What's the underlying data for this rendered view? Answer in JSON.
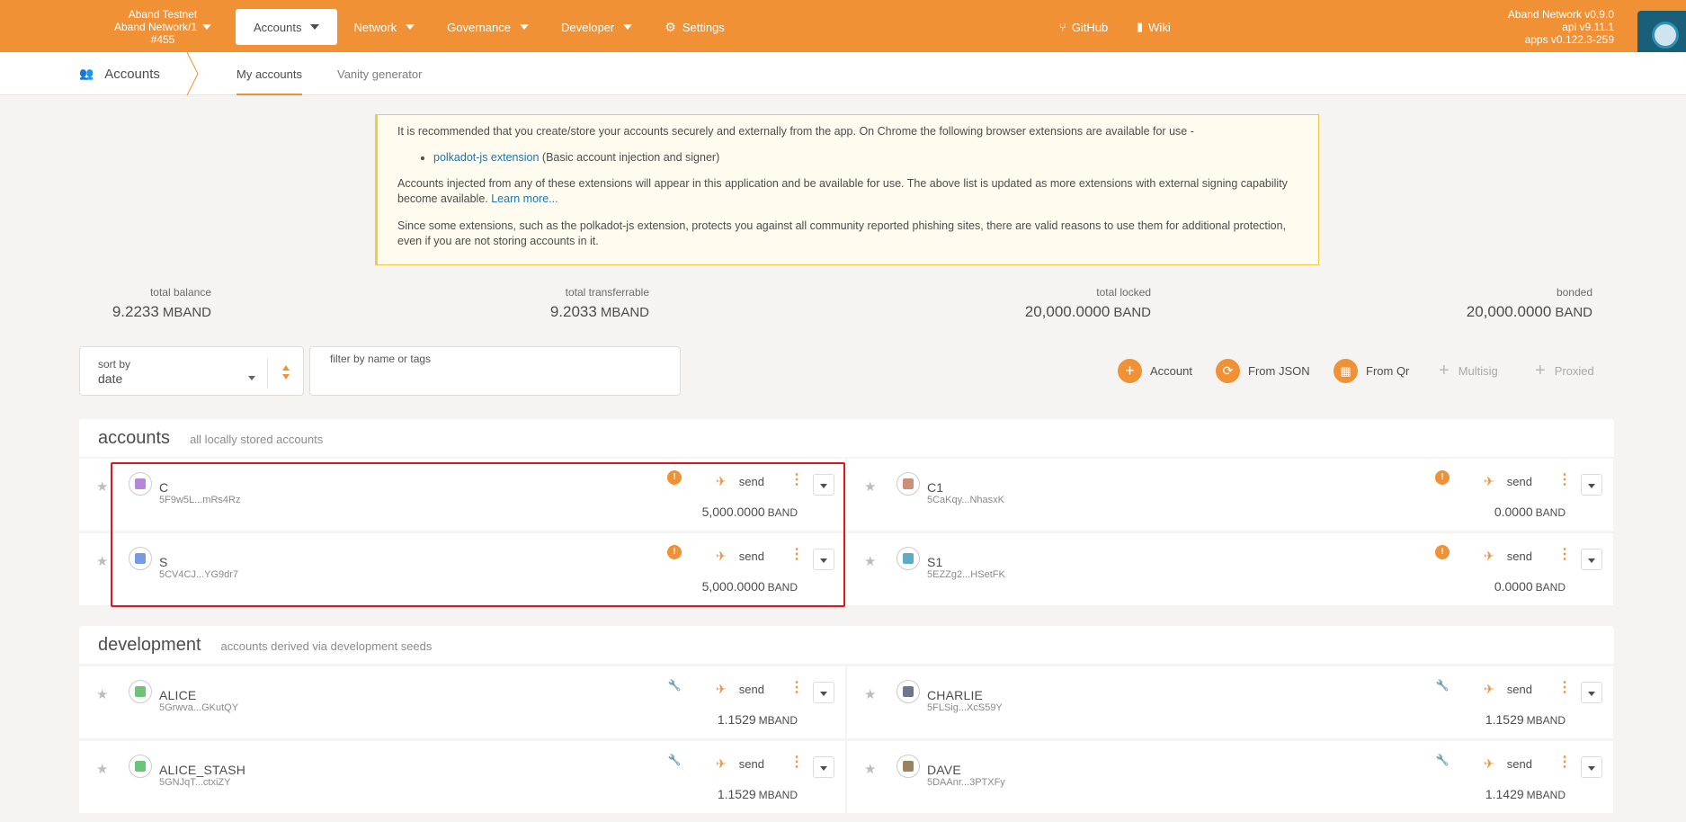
{
  "chain": {
    "line1": "Aband Testnet",
    "line2": "Aband Network/1",
    "block": "#455"
  },
  "nav": [
    {
      "label": "Accounts"
    },
    {
      "label": "Network"
    },
    {
      "label": "Governance"
    },
    {
      "label": "Developer"
    },
    {
      "label": "Settings"
    }
  ],
  "links": {
    "github": "GitHub",
    "wiki": "Wiki"
  },
  "version": {
    "node": "Aband Network v0.9.0",
    "api": "api v9.11.1",
    "apps": "apps v0.122.3-259"
  },
  "subnav": {
    "title": "Accounts",
    "tabs": [
      "My accounts",
      "Vanity generator"
    ]
  },
  "info": {
    "p1": "It is recommended that you create/store your accounts securely and externally from the app. On Chrome the following browser extensions are available for use -",
    "ext_link": "polkadot-js extension",
    "ext_desc": " (Basic account injection and signer)",
    "p2": "Accounts injected from any of these extensions will appear in this application and be available for use. The above list is updated as more extensions with external signing capability become available. ",
    "learn_more": "Learn more...",
    "p3": "Since some extensions, such as the polkadot-js extension, protects you against all community reported phishing sites, there are valid reasons to use them for additional protection, even if you are not storing accounts in it."
  },
  "totals": [
    {
      "label": "total balance",
      "value": "9.2233",
      "unit": "MBAND"
    },
    {
      "label": "total transferrable",
      "value": "9.2033",
      "unit": "MBAND"
    },
    {
      "label": "total locked",
      "value": "20,000.0000",
      "unit": "BAND"
    },
    {
      "label": "bonded",
      "value": "20,000.0000",
      "unit": "BAND"
    }
  ],
  "sort": {
    "label": "sort by",
    "value": "date"
  },
  "filter": {
    "label": "filter by name or tags",
    "value": ""
  },
  "actions": [
    "Account",
    "From JSON",
    "From Qr",
    "Multisig",
    "Proxied"
  ],
  "sections": {
    "accounts": {
      "title": "accounts",
      "subtitle": "all locally stored accounts"
    },
    "development": {
      "title": "development",
      "subtitle": "accounts derived via development seeds"
    }
  },
  "send_label": "send",
  "accounts": [
    {
      "name": "C",
      "address": "5F9w5L...mRs4Rz",
      "balance": "5,000.0000",
      "unit": "BAND",
      "badge": "warning",
      "color": "#9b5fc9"
    },
    {
      "name": "C1",
      "address": "5CaKqy...NhasxK",
      "balance": "0.0000",
      "unit": "BAND",
      "badge": "warning",
      "color": "#b96b4a"
    },
    {
      "name": "S",
      "address": "5CV4CJ...YG9dr7",
      "balance": "5,000.0000",
      "unit": "BAND",
      "badge": "warning",
      "color": "#4a78d8"
    },
    {
      "name": "S1",
      "address": "5EZZg2...HSetFK",
      "balance": "0.0000",
      "unit": "BAND",
      "badge": "warning",
      "color": "#2a8fb0"
    }
  ],
  "development": [
    {
      "name": "ALICE",
      "address": "5Grwva...GKutQY",
      "balance": "1.1529",
      "unit": "MBAND",
      "badge": "wrench",
      "color": "#3fae4a"
    },
    {
      "name": "CHARLIE",
      "address": "5FLSig...XcS59Y",
      "balance": "1.1529",
      "unit": "MBAND",
      "badge": "wrench",
      "color": "#3a4a6a"
    },
    {
      "name": "ALICE_STASH",
      "address": "5GNJqT...ctxiZY",
      "balance": "1.1529",
      "unit": "MBAND",
      "badge": "wrench",
      "color": "#36b34a"
    },
    {
      "name": "DAVE",
      "address": "5DAAnr...3PTXFy",
      "balance": "1.1429",
      "unit": "MBAND",
      "badge": "wrench",
      "color": "#7a5a2a"
    }
  ]
}
